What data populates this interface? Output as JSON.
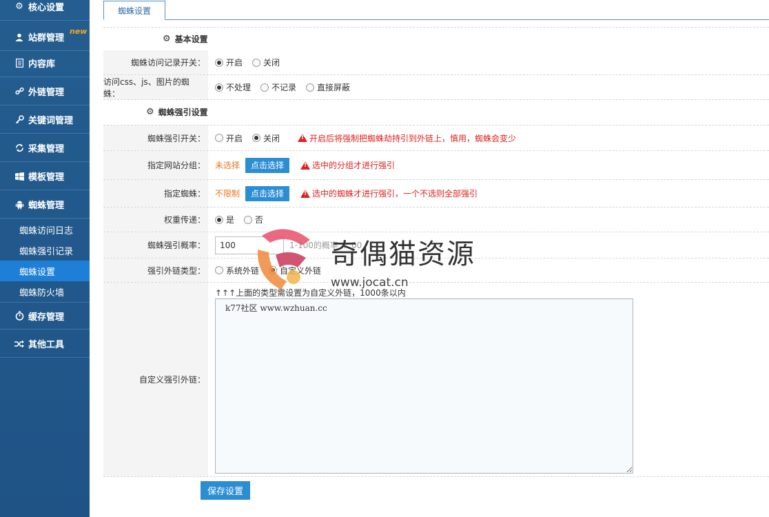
{
  "sidebar": {
    "items": [
      {
        "label": "核心设置",
        "icon": "gear-icon"
      },
      {
        "label": "站群管理",
        "icon": "user-icon",
        "badge": "new"
      },
      {
        "label": "内容库",
        "icon": "document-icon"
      },
      {
        "label": "外链管理",
        "icon": "link-icon"
      },
      {
        "label": "关键词管理",
        "icon": "key-icon"
      },
      {
        "label": "采集管理",
        "icon": "refresh-icon"
      },
      {
        "label": "模板管理",
        "icon": "windows-icon"
      },
      {
        "label": "蜘蛛管理",
        "icon": "android-icon"
      }
    ],
    "sub_items": [
      {
        "label": "蜘蛛访问日志"
      },
      {
        "label": "蜘蛛强引记录"
      },
      {
        "label": "蜘蛛设置",
        "active": true
      },
      {
        "label": "蜘蛛防火墙"
      }
    ],
    "bottom_items": [
      {
        "label": "缓存管理",
        "icon": "timer-icon"
      },
      {
        "label": "其他工具",
        "icon": "shuffle-icon"
      }
    ]
  },
  "tab": {
    "label": "蜘蛛设置"
  },
  "sections": {
    "basic": "基本设置",
    "force": "蜘蛛强引设置"
  },
  "form": {
    "visit_log": {
      "label": "蜘蛛访问记录开关：",
      "options": [
        "开启",
        "关闭"
      ],
      "selected": "开启"
    },
    "static_spider": {
      "label": "访问css、js、图片的蜘蛛：",
      "options": [
        "不处理",
        "不记录",
        "直接屏蔽"
      ],
      "selected": "不处理"
    },
    "force_switch": {
      "label": "蜘蛛强引开关：",
      "options": [
        "开启",
        "关闭"
      ],
      "selected": "关闭",
      "warning": "开启后将强制把蜘蛛劫持引到外链上，慎用，蜘蛛会变少"
    },
    "site_group": {
      "label": "指定网站分组：",
      "status": "未选择",
      "button": "点击选择",
      "warning": "选中的分组才进行强引"
    },
    "spider": {
      "label": "指定蜘蛛：",
      "status": "不限制",
      "button": "点击选择",
      "warning": "选中的蜘蛛才进行强引，一个不选则全部强引"
    },
    "weight": {
      "label": "权重传递：",
      "options": [
        "是",
        "否"
      ],
      "selected": "是"
    },
    "probability": {
      "label": "蜘蛛强引概率：",
      "value": "100",
      "hint": "1-100的概率 ... 00"
    },
    "link_type": {
      "label": "强引外链类型：",
      "options": [
        "系统外链",
        "自定义外链"
      ],
      "selected": "自定义外链"
    },
    "custom_links": {
      "label": "自定义强引外链：",
      "hint": "↑↑↑上面的类型需设置为自定义外链，1000条以内",
      "value": "k77社区 www.wzhuan.cc"
    }
  },
  "save_button": "保存设置",
  "watermark": {
    "title": "奇偶猫资源",
    "url": "www.jocat.cn"
  },
  "colors": {
    "sidebar_bg": "#245d8f",
    "active": "#1e7fd6",
    "button": "#2b8ed3",
    "warning": "#e02020",
    "orange": "#e87722"
  }
}
